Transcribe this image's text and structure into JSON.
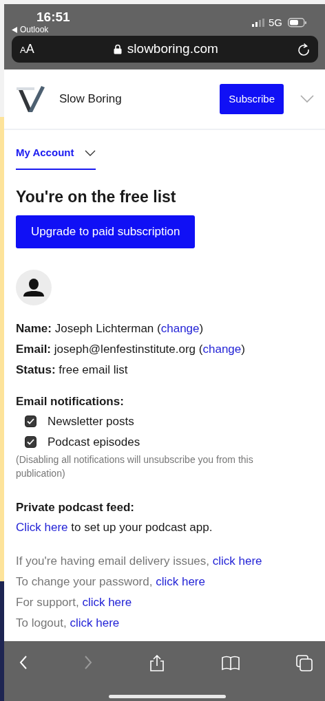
{
  "status_bar": {
    "time": "16:51",
    "back_app": "Outlook",
    "network": "5G"
  },
  "url_bar": {
    "text_size_small": "A",
    "text_size_large": "A",
    "address": "slowboring.com"
  },
  "header": {
    "publication": "Slow Boring",
    "subscribe_button": "Subscribe"
  },
  "tabs": [
    {
      "label": "My Account",
      "selected": true
    }
  ],
  "heading": "You're on the free list",
  "upgrade_button": "Upgrade to paid subscription",
  "profile": [
    {
      "label": "Name:",
      "value": " Joseph Lichterman (",
      "link": "change",
      "after": ")"
    },
    {
      "label": "Email:",
      "value": " joseph@lenfestinstitute.org (",
      "link": "change",
      "after": ")"
    },
    {
      "label": "Status:",
      "value": " free email list"
    }
  ],
  "notifications": {
    "title": "Email notifications:",
    "options": [
      {
        "label": "Newsletter posts",
        "checked": true
      },
      {
        "label": "Podcast episodes",
        "checked": true
      }
    ],
    "note": "(Disabling all notifications will unsubscribe you from this publication)"
  },
  "podcast": {
    "title": "Private podcast feed:",
    "link": "Click here",
    "text": " to set up your podcast app."
  },
  "help_lines": [
    {
      "text": "If you're having email delivery issues, ",
      "link": "click here"
    },
    {
      "text": "To change your password, ",
      "link": "click here"
    },
    {
      "text": "For support, ",
      "link": "click here"
    },
    {
      "text": "To logout, ",
      "link": "click here"
    }
  ],
  "toolbar": [
    {
      "kind": "back",
      "disabled": false
    },
    {
      "kind": "forward",
      "disabled": true
    },
    {
      "kind": "share",
      "disabled": false
    },
    {
      "kind": "bookmarks",
      "disabled": false
    },
    {
      "kind": "tabs",
      "disabled": false
    }
  ]
}
